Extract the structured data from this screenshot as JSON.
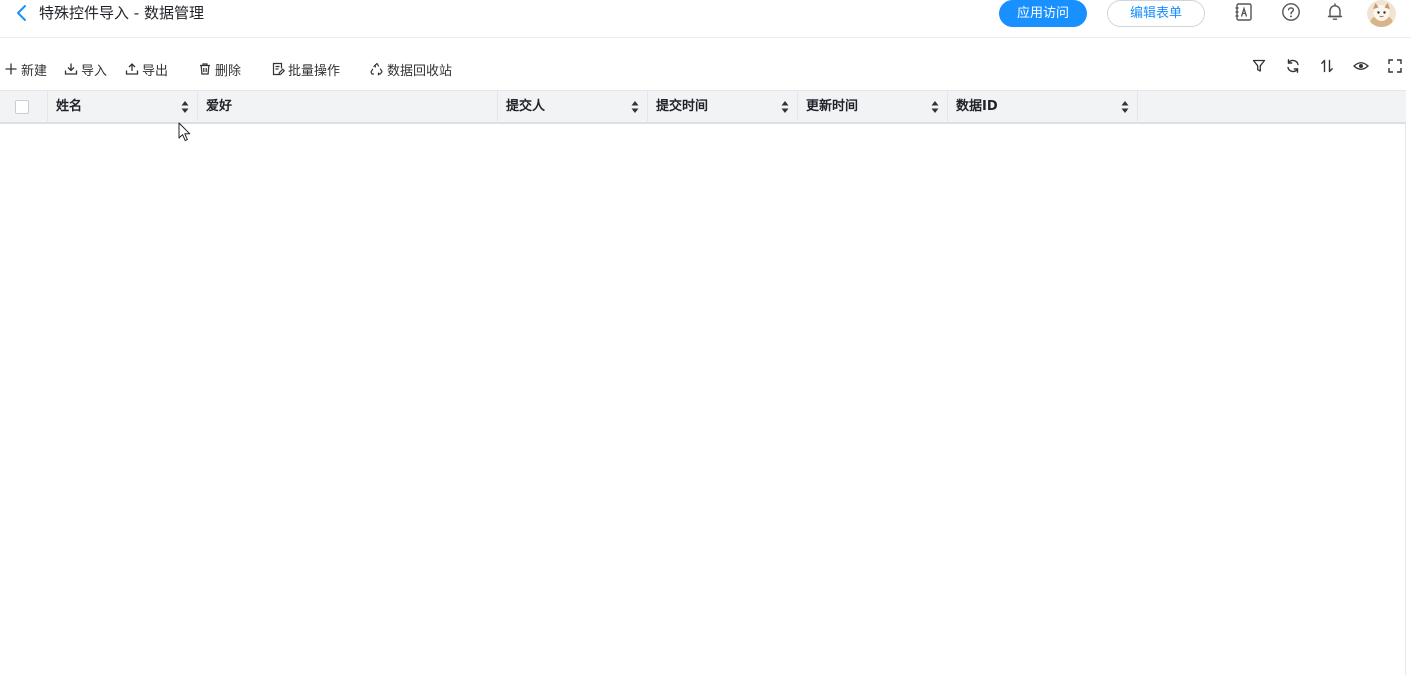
{
  "header": {
    "title": "特殊控件导入 - 数据管理",
    "app_access_label": "应用访问",
    "edit_form_label": "编辑表单"
  },
  "toolbar": {
    "new_label": "新建",
    "import_label": "导入",
    "export_label": "导出",
    "delete_label": "删除",
    "batch_label": "批量操作",
    "recycle_label": "数据回收站"
  },
  "table": {
    "columns": [
      "姓名",
      "爱好",
      "提交人",
      "提交时间",
      "更新时间",
      "数据ID"
    ]
  },
  "colors": {
    "primary": "#1890ff",
    "header_bg": "#f2f3f5"
  }
}
